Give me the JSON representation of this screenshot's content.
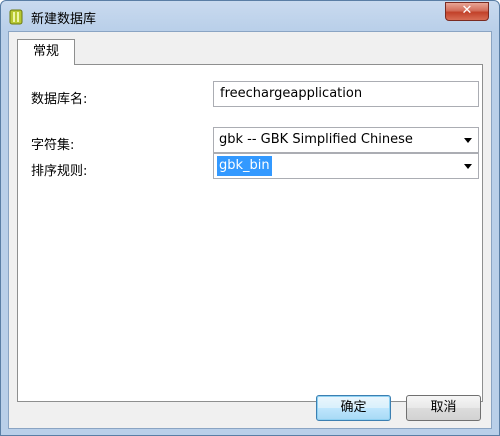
{
  "window": {
    "title": "新建数据库",
    "close_glyph": "✕",
    "icon": "database-icon"
  },
  "tabs": [
    {
      "label": "常规",
      "active": true
    }
  ],
  "form": {
    "db_name_label": "数据库名:",
    "db_name_value": "freechargeapplication",
    "charset_label": "字符集:",
    "charset_value": "gbk -- GBK Simplified Chinese",
    "collation_label": "排序规则:",
    "collation_value": "gbk_bin"
  },
  "buttons": {
    "ok": "确定",
    "cancel": "取消"
  },
  "colors": {
    "selection": "#3399ff",
    "close_button": "#c2412a",
    "frame": "#b9cfe9"
  }
}
